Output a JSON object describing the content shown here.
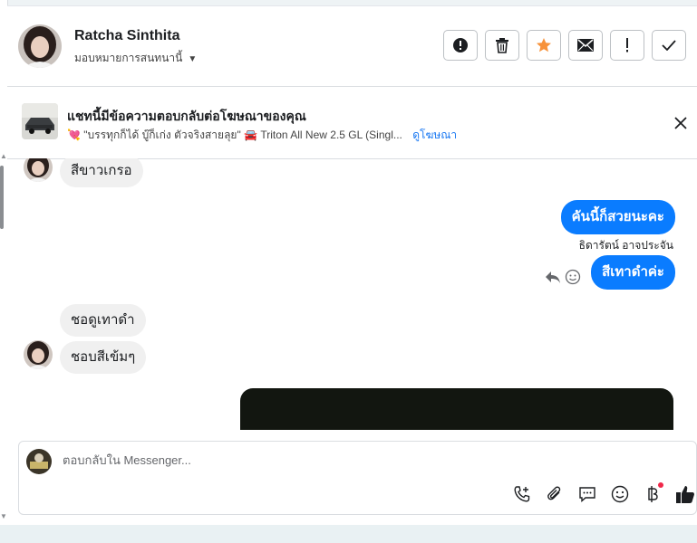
{
  "header": {
    "name": "Ratcha Sinthita",
    "assign_label": "มอบหมายการสนทนานี้",
    "actions": [
      "spam-icon",
      "trash-icon",
      "star-icon",
      "mail-icon",
      "exclamation-icon",
      "check-icon"
    ]
  },
  "ad": {
    "title": "แชทนี้มีข้อความตอบกลับต่อโฆษณาของคุณ",
    "emoji1": "💘",
    "caption": "\"บรรทุกก็ได้ บู๊ก็เก่ง ตัวจริงสายลุย\"",
    "emoji2": "🚘",
    "product": "Triton All New 2.5 GL (Singl...",
    "view_link": "ดูโฆษณา"
  },
  "conversation": {
    "msg1": "สีขาวเกรอ",
    "msg2": "คันนี้ก็สวยนะคะ",
    "sender": "ธิดารัตน์ อาจประจัน",
    "msg3": "สีเทาดำค่ะ",
    "msg4": "ชอดูเทาดำ",
    "msg5": "ชอบสีเข้มๆ"
  },
  "composer": {
    "placeholder": "ตอบกลับใน Messenger..."
  },
  "colors": {
    "accent": "#0a7cff",
    "star": "#f7923a",
    "badge": "#f02849"
  }
}
